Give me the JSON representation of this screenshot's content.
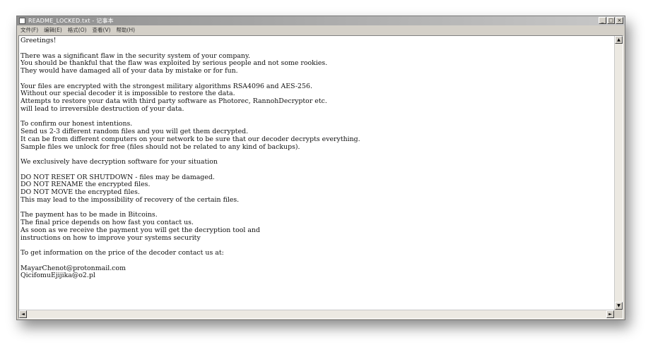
{
  "window": {
    "title": "README_LOCKED.txt - 记事本",
    "buttons": {
      "minimize": "_",
      "maximize": "□",
      "close": "×"
    }
  },
  "menu": [
    {
      "label": "文件(F)"
    },
    {
      "label": "编辑(E)"
    },
    {
      "label": "格式(O)"
    },
    {
      "label": "查看(V)"
    },
    {
      "label": "帮助(H)"
    }
  ],
  "document": {
    "lines": [
      "Greetings!",
      "",
      "There was a significant flaw in the security system of your company.",
      "You should be thankful that the flaw was exploited by serious people and not some rookies.",
      "They would have damaged all of your data by mistake or for fun.",
      "",
      "Your files are encrypted with the strongest military algorithms RSA4096 and AES-256.",
      "Without our special decoder it is impossible to restore the data.",
      "Attempts to restore your data with third party software as Photorec, RannohDecryptor etc.",
      "will lead to irreversible destruction of your data.",
      "",
      "To confirm our honest intentions.",
      "Send us 2-3 different random files and you will get them decrypted.",
      "It can be from different computers on your network to be sure that our decoder decrypts everything.",
      "Sample files we unlock for free (files should not be related to any kind of backups).",
      "",
      "We exclusively have decryption software for your situation",
      "",
      "DO NOT RESET OR SHUTDOWN - files may be damaged.",
      "DO NOT RENAME the encrypted files.",
      "DO NOT MOVE the encrypted files.",
      "This may lead to the impossibility of recovery of the certain files.",
      "",
      "The payment has to be made in Bitcoins.",
      "The final price depends on how fast you contact us.",
      "As soon as we receive the payment you will get the decryption tool and",
      "instructions on how to improve your systems security",
      "",
      "To get information on the price of the decoder contact us at:",
      "",
      "MayarChenot@protonmail.com",
      "QicifomuEjijika@o2.pl"
    ]
  },
  "scrollbars": {
    "up_arrow": "▲",
    "down_arrow": "▼",
    "left_arrow": "◄",
    "right_arrow": "►"
  }
}
